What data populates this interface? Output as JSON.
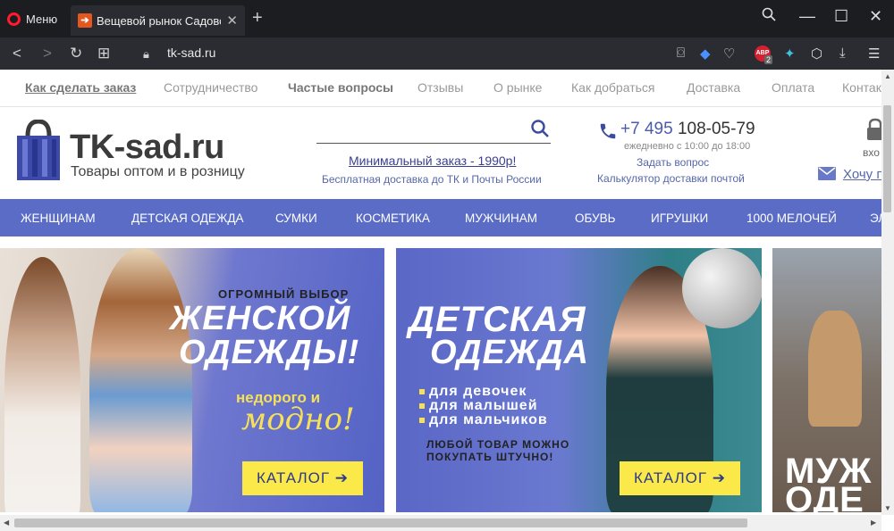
{
  "browser": {
    "menu_label": "Меню",
    "tab_title": "Вещевой рынок Садовод",
    "url": "tk-sad.ru",
    "abp_label": "ABP",
    "abp_count": "2"
  },
  "topmenu": [
    {
      "label": "Как сделать заказ"
    },
    {
      "label": "Сотрудничество"
    },
    {
      "label": "Частые вопросы"
    },
    {
      "label": "Отзывы"
    },
    {
      "label": "О рынке"
    },
    {
      "label": "Как добраться"
    },
    {
      "label": "Доставка"
    },
    {
      "label": "Оплата"
    },
    {
      "label": "Контак"
    }
  ],
  "header": {
    "logo_name": "TK-sad.ru",
    "logo_tagline": "Товары оптом и в розницу",
    "min_order": "Минимальный заказ - 1990р!",
    "free_delivery": "Бесплатная доставка до ТК и Почты России",
    "phone_code": "+7 495",
    "phone_number": "108-05-79",
    "hours": "ежедневно с 10:00 до 18:00",
    "ask_question": "Задать вопрос",
    "calculator": "Калькулятор доставки почтой",
    "login": "вхо",
    "want": "Хочу п"
  },
  "categories": [
    {
      "label": "ЖЕНЩИНАМ"
    },
    {
      "label": "ДЕТСКАЯ ОДЕЖДА"
    },
    {
      "label": "СУМКИ"
    },
    {
      "label": "КОСМЕТИКА"
    },
    {
      "label": "МУЖЧИНАМ"
    },
    {
      "label": "ОБУВЬ"
    },
    {
      "label": "ИГРУШКИ"
    },
    {
      "label": "1000 МЕЛОЧЕЙ"
    },
    {
      "label": "ЭЛ"
    }
  ],
  "banners": {
    "women": {
      "small": "ОГРОМНЫЙ ВЫБОР",
      "big1": "ЖЕНСКОЙ",
      "big2": "ОДЕЖДЫ!",
      "cheap": "недорого и",
      "fashion": "модно!",
      "button": "КАТАЛОГ ➔"
    },
    "kids": {
      "big1": "ДЕТСКАЯ",
      "big2": "ОДЕЖДА",
      "bullets": [
        "для девочек",
        "для малышей",
        "для мальчиков"
      ],
      "note1": "ЛЮБОЙ ТОВАР МОЖНО",
      "note2": "ПОКУПАТЬ ШТУЧНО!",
      "button": "КАТАЛОГ ➔"
    },
    "men": {
      "big1": "МУЖ",
      "big2": "ОДЕ"
    }
  },
  "colors": {
    "accent": "#5b6cc6",
    "yellow": "#fbe94a",
    "link": "#5567a8"
  }
}
